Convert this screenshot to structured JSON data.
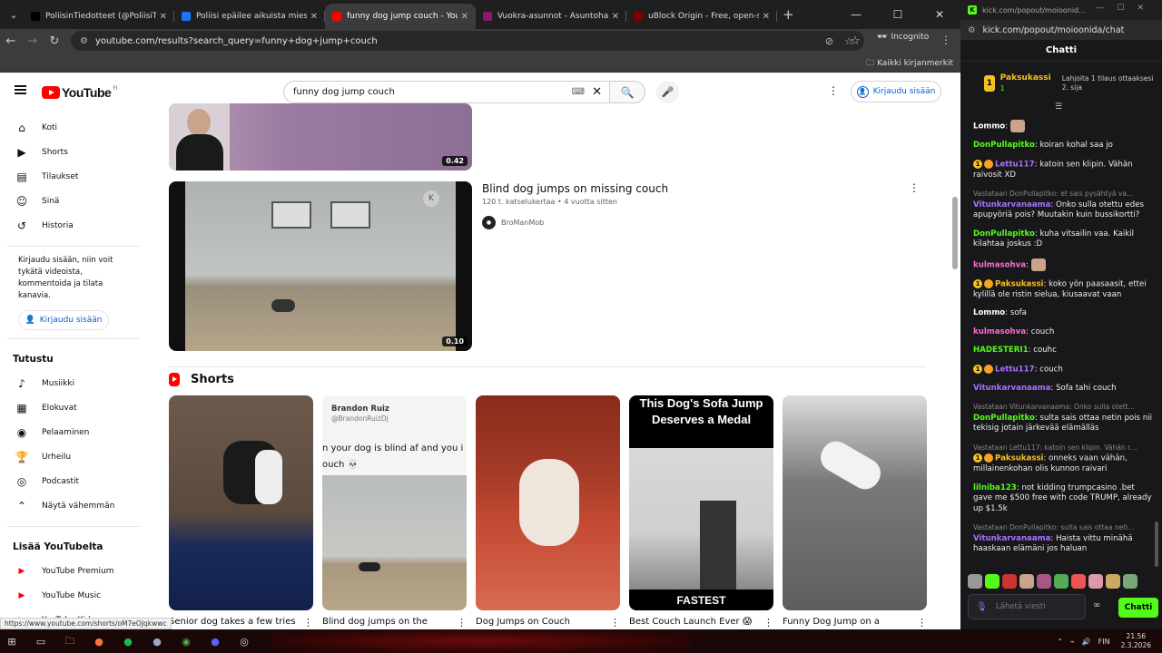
{
  "browser": {
    "tabs": [
      {
        "title": "PoliisinTiedotteet (@PoliisiTied…",
        "color": "#000000"
      },
      {
        "title": "Poliisi epäilee aikuista miestä is…",
        "color": "#1877f2"
      },
      {
        "title": "funny dog jump couch - YouTu…",
        "color": "#ff0000",
        "active": true
      },
      {
        "title": "Vuokra-asunnot - Asuntohaku …",
        "color": "#8b1a6b"
      },
      {
        "title": "uBlock Origin - Free, open-sou…",
        "color": "#800000"
      }
    ],
    "url": "youtube.com/results?search_query=funny+dog+jump+couch",
    "profile_label": "Incognito",
    "bookmarks_label": "Kaikki kirjanmerkit"
  },
  "youtube": {
    "logo_text": "YouTube",
    "country_code": "FI",
    "search_value": "funny dog jump couch",
    "signin_label": "Kirjaudu sisään",
    "sidebar": {
      "main": [
        {
          "label": "Koti",
          "icon": "home-icon"
        },
        {
          "label": "Shorts",
          "icon": "shorts-icon"
        },
        {
          "label": "Tilaukset",
          "icon": "subscriptions-icon"
        },
        {
          "label": "Sinä",
          "icon": "you-icon"
        },
        {
          "label": "Historia",
          "icon": "history-icon"
        }
      ],
      "signin_note": "Kirjaudu sisään, niin voit tykätä videoista, kommentoida ja tilata kanavia.",
      "signin_label": "Kirjaudu sisään",
      "explore_heading": "Tutustu",
      "explore": [
        {
          "label": "Musiikki",
          "icon": "music-icon"
        },
        {
          "label": "Elokuvat",
          "icon": "movies-icon"
        },
        {
          "label": "Pelaaminen",
          "icon": "gaming-icon"
        },
        {
          "label": "Urheilu",
          "icon": "sports-icon"
        },
        {
          "label": "Podcastit",
          "icon": "podcast-icon"
        },
        {
          "label": "Näytä vähemmän",
          "icon": "chevron-up-icon"
        }
      ],
      "more_heading": "Lisää YouTubelta",
      "more": [
        {
          "label": "YouTube Premium"
        },
        {
          "label": "YouTube Music"
        },
        {
          "label": "YouTube Kids"
        }
      ]
    },
    "videos": [
      {
        "duration": "0.42"
      },
      {
        "title": "Blind dog jumps on missing couch",
        "meta": "120 t. katselukertaa • 4 vuotta sitten",
        "channel": "BroManMob",
        "duration": "0.10"
      }
    ],
    "shorts_heading": "Shorts",
    "shorts": [
      {
        "title": "Senior dog takes a few tries"
      },
      {
        "title": "Blind dog jumps on the",
        "overlay_name": "Brandon Ruiz",
        "overlay_handle": "@BrandonRuizDj",
        "overlay_text": "n your dog is blind af and you i",
        "overlay_text2": "ouch 💀"
      },
      {
        "title": "Dog Jumps on Couch"
      },
      {
        "title": "Best Couch Launch Ever 😱",
        "overlay_top": "This Dog's Sofa Jump Deserves a Medal",
        "overlay_bottom": "FASTEST"
      },
      {
        "title": "Funny Dog Jump on a"
      }
    ],
    "status_url": "https://www.youtube.com/shorts/oM7eOJqkwwc"
  },
  "kick": {
    "tab_title": "kick.com/popout/moioonid…",
    "url": "kick.com/popout/moioonida/chat",
    "header": "Chatti",
    "pinned": {
      "rank": "1",
      "name": "Paksukassi",
      "count": "1",
      "gift_text": "Lahjoita 1 tilaus ottaaksesi 2. sija"
    },
    "messages": [
      {
        "user": "Lommo",
        "color": "#ffffff",
        "text": "",
        "emote": true
      },
      {
        "user": "DonPullapitko",
        "color": "#53fc18",
        "text": "koiran kohal saa jo"
      },
      {
        "user": "Lettu117",
        "color": "#a970ff",
        "text": "katoin sen klipin. Vähän raivosit XD",
        "badges": true
      },
      {
        "reply": "Vastataan DonPullapitko: et sais pysähtyä va…",
        "user": "Vitunkarvanaama",
        "color": "#a970ff",
        "text": "Onko sulla otettu edes apupyöriä pois? Muutakin kuin bussikortti?"
      },
      {
        "user": "DonPullapitko",
        "color": "#53fc18",
        "text": "kuha vitsailin vaa. Kaikil kilahtaa joskus :D"
      },
      {
        "user": "kulmasohva",
        "color": "#ff6ad5",
        "text": "",
        "emote": true
      },
      {
        "user": "Paksukassi",
        "color": "#f7c21f",
        "text": "koko yön paasaasit, ettei kylillä ole ristin sielua, kiusaavat vaan",
        "badges": true
      },
      {
        "user": "Lommo",
        "color": "#ffffff",
        "text": "sofa"
      },
      {
        "user": "kulmasohva",
        "color": "#ff6ad5",
        "text": "couch"
      },
      {
        "user": "HADESTERI1",
        "color": "#53fc18",
        "text": "couhc"
      },
      {
        "user": "Lettu117",
        "color": "#a970ff",
        "text": "couch",
        "badges": true
      },
      {
        "user": "Vitunkarvanaama",
        "color": "#a970ff",
        "text": "Sofa tahi couch"
      },
      {
        "reply": "Vastataan Vitunkarvanaama: Onko sulla otett…",
        "user": "DonPullapitko",
        "color": "#53fc18",
        "text": "sulta sais ottaa netin pois nii tekisig jotain järkevää elämälläs"
      },
      {
        "reply": "Vastataan Lettu117: katoin sen klipin. Vähän r…",
        "user": "Paksukassi",
        "color": "#f7c21f",
        "text": "onneks vaan vähän, millainenkohan olis kunnon raivari",
        "badges": true
      },
      {
        "user": "lilniba123",
        "color": "#53fc18",
        "text": "not kidding trumpcasino .bet gave me $500 free with code TRUMP, already up $1.5k"
      },
      {
        "reply": "Vastataan DonPullapitko: sulta sais ottaa neti…",
        "user": "Vitunkarvanaama",
        "color": "#a970ff",
        "text": "Haista vittu minähä haaskaan elämäni jos haluan"
      }
    ],
    "input_placeholder": "Lähetä viesti",
    "send_label": "Chatti"
  },
  "taskbar": {
    "lang": "FIN",
    "time": "21.56",
    "date": "2.3.2026"
  }
}
